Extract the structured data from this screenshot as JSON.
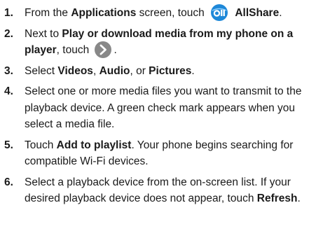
{
  "steps": [
    {
      "number": "1.",
      "part1": "From the ",
      "bold1": "Applications",
      "part2": " screen, touch",
      "icon": "allshare-app-icon",
      "bold2": "AllShare",
      "part3": "."
    },
    {
      "number": "2.",
      "part1": "Next to ",
      "bold1": "Play or download media from my phone on a player",
      "part2": ", touch",
      "icon": "arrow-right-circle-icon",
      "part3": "."
    },
    {
      "number": "3.",
      "part1": "Select ",
      "bold1": "Videos",
      "part2": ", ",
      "bold2": "Audio",
      "part3": ", or ",
      "bold3": "Pictures",
      "part4": "."
    },
    {
      "number": "4.",
      "text": "Select one or more media files you want to transmit to the playback device. A green check mark appears when you select a media file."
    },
    {
      "number": "5.",
      "part1": "Touch ",
      "bold1": "Add to playlist",
      "part2": ". Your phone begins searching for compatible Wi-Fi devices."
    },
    {
      "number": "6.",
      "part1": "Select a playback device from the on-screen list. If your desired playback device does not appear, touch ",
      "bold1": "Refresh",
      "part2": "."
    }
  ],
  "colors": {
    "allshare_icon": "#1e88d8",
    "arrow_icon": "#888888"
  }
}
